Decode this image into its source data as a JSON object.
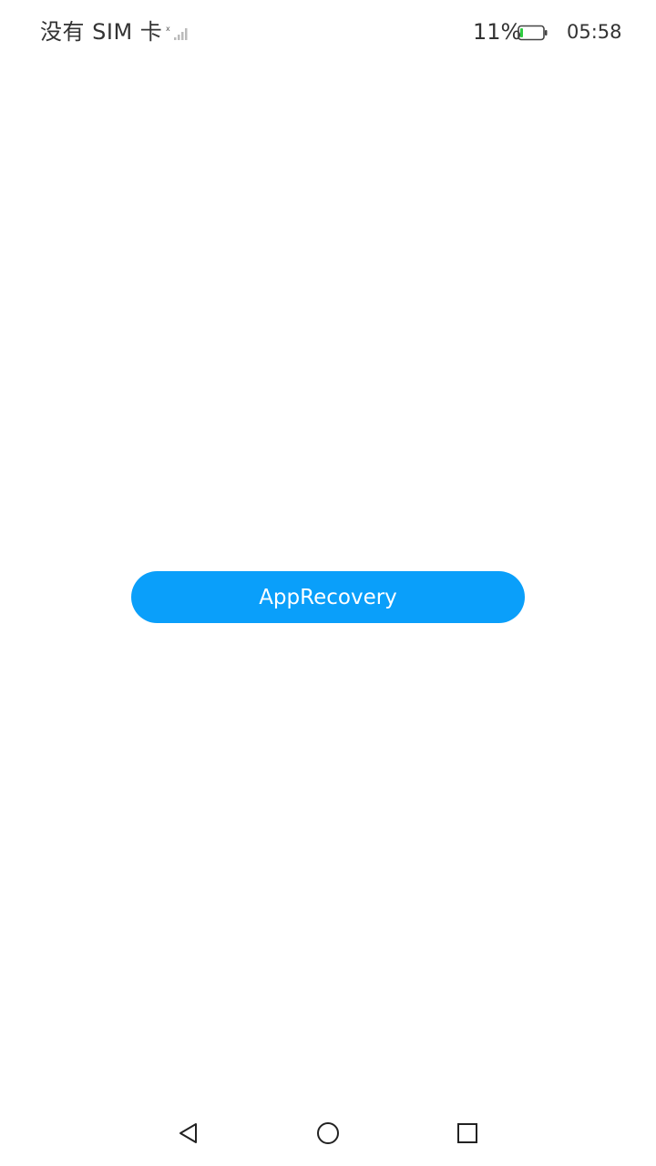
{
  "status_bar": {
    "carrier": "没有 SIM 卡",
    "signal_icon": "signal-no-sim-icon",
    "battery_percent": "11%",
    "battery_icon": "battery-low-icon",
    "battery_level": 0.11,
    "battery_accent": "#2ecc40",
    "time": "05:58"
  },
  "main": {
    "button_label": "AppRecovery",
    "button_color": "#0a9ffa"
  },
  "nav_bar": {
    "back_icon": "back-triangle-icon",
    "home_icon": "home-circle-icon",
    "recent_icon": "recent-apps-square-icon"
  }
}
